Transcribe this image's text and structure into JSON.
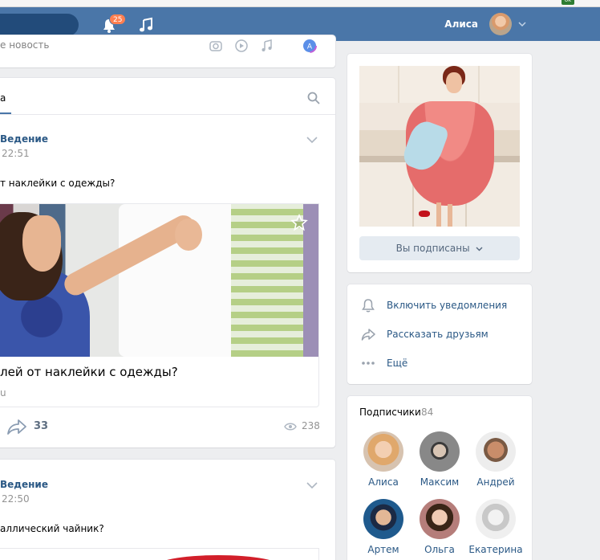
{
  "header": {
    "notifications_count": "25",
    "user_name": "Алиса"
  },
  "composer": {
    "placeholder": "е новость"
  },
  "feed": {
    "tab_label": "а",
    "posts": [
      {
        "author": "Ведение",
        "time": "22:51",
        "text": "т наклейки с одежды?",
        "attachment_title": "лей от наклейки с одежды?",
        "attachment_source": "u",
        "shares": "33",
        "views": "238"
      },
      {
        "author": "Ведение",
        "time": "22:50",
        "text": "аллический чайник?"
      }
    ]
  },
  "profile": {
    "subscribed_label": "Вы подписаны"
  },
  "actions": [
    {
      "label": "Включить уведомления",
      "icon": "bell-icon"
    },
    {
      "label": "Рассказать друзьям",
      "icon": "share-icon"
    },
    {
      "label": "Ещё",
      "icon": "more-icon"
    }
  ],
  "subscribers": {
    "title": "Подписчики",
    "count": "84",
    "people": [
      {
        "name": "Алиса"
      },
      {
        "name": "Максим"
      },
      {
        "name": "Андрей"
      },
      {
        "name": "Артем"
      },
      {
        "name": "Ольга"
      },
      {
        "name": "Екатерина"
      }
    ]
  },
  "colors": {
    "header": "#4a76a8",
    "link": "#2a5885",
    "badge": "#ff7f50",
    "background": "#edeef0"
  }
}
